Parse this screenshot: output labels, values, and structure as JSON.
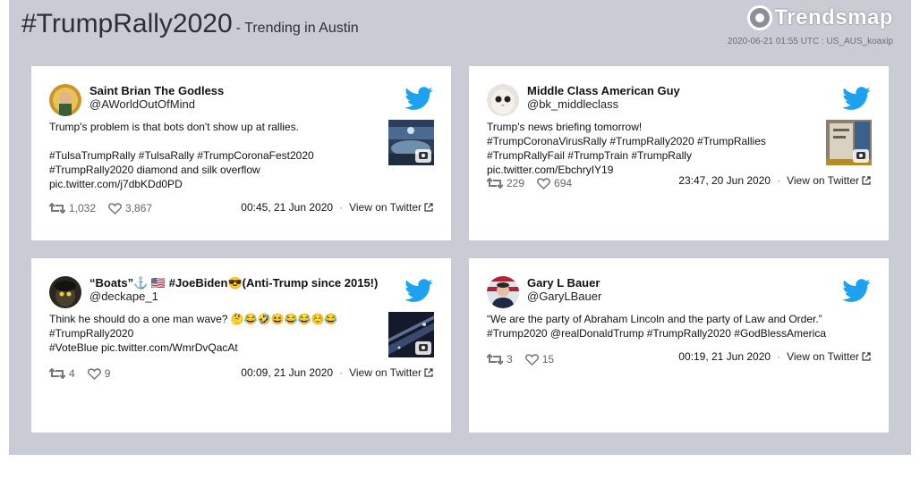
{
  "header": {
    "title": "#TrumpRally2020",
    "subtitle": "- Trending in Austin",
    "brand": "Trendsmap",
    "meta": "2020-06-21 01:55 UTC : US_AUS_koaxip"
  },
  "colors": {
    "twitter_blue": "#1da1f2",
    "background": "#c9ccd4",
    "card": "#ffffff"
  },
  "tweets": [
    {
      "name": "Saint Brian The Godless",
      "handle": "@AWorldOutOfMind",
      "text": "Trump's problem is that bots don't show up at rallies.\n\n#TulsaTrumpRally #TulsaRally #TrumpCoronaFest2020\n#TrumpRally2020 diamond and silk overflow\npic.twitter.com/j7dbKDd0PD",
      "retweets": "1,032",
      "likes": "3,867",
      "date": "00:45, 21 Jun 2020",
      "link": "View on Twitter",
      "has_media": true
    },
    {
      "name": "Middle Class American Guy",
      "handle": "@bk_middleclass",
      "text": "Trump's news briefing tomorrow!\n#TrumpCoronaVirusRally #TrumpRally2020 #TrumpRallies\n#TrumpRallyFail #TrumpTrain #TrumpRally pic.twitter.com/EbchryIY19",
      "retweets": "229",
      "likes": "694",
      "date": "23:47, 20 Jun 2020",
      "link": "View on Twitter",
      "has_media": true
    },
    {
      "name": "“Boats”⚓️ 🇺🇸 #JoeBiden😎(Anti-Trump since 2015!)",
      "handle": "@deckape_1",
      "text": "Think he should do a one man wave? 🤔😂🤣😆😂😂☺️😂\n#TrumpRally2020\n#VoteBlue pic.twitter.com/WmrDvQacAt",
      "retweets": "4",
      "likes": "9",
      "date": "00:09, 21 Jun 2020",
      "link": "View on Twitter",
      "has_media": true
    },
    {
      "name": "Gary L Bauer",
      "handle": "@GaryLBauer",
      "text": "“We are the party of Abraham Lincoln and the party of Law and Order.”\n#Trump2020 @realDonaldTrump #TrumpRally2020 #GodBlessAmerica",
      "retweets": "3",
      "likes": "15",
      "date": "00:19, 21 Jun 2020",
      "link": "View on Twitter",
      "has_media": false
    }
  ]
}
